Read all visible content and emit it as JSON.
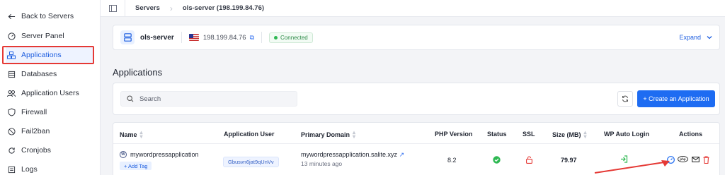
{
  "sidebar": {
    "back_label": "Back to Servers",
    "items": [
      {
        "label": "Server Panel",
        "icon": "gauge-icon"
      },
      {
        "label": "Applications",
        "icon": "apps-icon",
        "active": true
      },
      {
        "label": "Databases",
        "icon": "database-icon"
      },
      {
        "label": "Application Users",
        "icon": "users-icon"
      },
      {
        "label": "Firewall",
        "icon": "shield-icon"
      },
      {
        "label": "Fail2ban",
        "icon": "ban-icon"
      },
      {
        "label": "Cronjobs",
        "icon": "refresh-icon"
      },
      {
        "label": "Logs",
        "icon": "logs-icon"
      }
    ]
  },
  "breadcrumb": {
    "items": [
      "Servers",
      "ols-server (198.199.84.76)"
    ]
  },
  "server": {
    "name": "ols-server",
    "ip": "198.199.84.76",
    "status": "Connected",
    "expand_label": "Expand"
  },
  "page": {
    "title": "Applications"
  },
  "toolbar": {
    "search_placeholder": "Search",
    "create_label": "+ Create an Application"
  },
  "table": {
    "headers": [
      "Name",
      "Application User",
      "Primary Domain",
      "PHP Version",
      "Status",
      "SSL",
      "Size (MB)",
      "WP Auto Login",
      "Actions"
    ],
    "rows": [
      {
        "name": "mywordpressapplication",
        "add_tag": "+ Add Tag",
        "user": "Gbusvn6jat9qUnVv",
        "domain": "mywordpressapplication.salite.xyz",
        "domain_sub": "13 minutes ago",
        "php": "8.2",
        "size": "79.97"
      }
    ]
  },
  "colors": {
    "accent": "#1e6cf2",
    "highlight": "#e53935",
    "success": "#2eb852",
    "danger": "#e53935"
  }
}
